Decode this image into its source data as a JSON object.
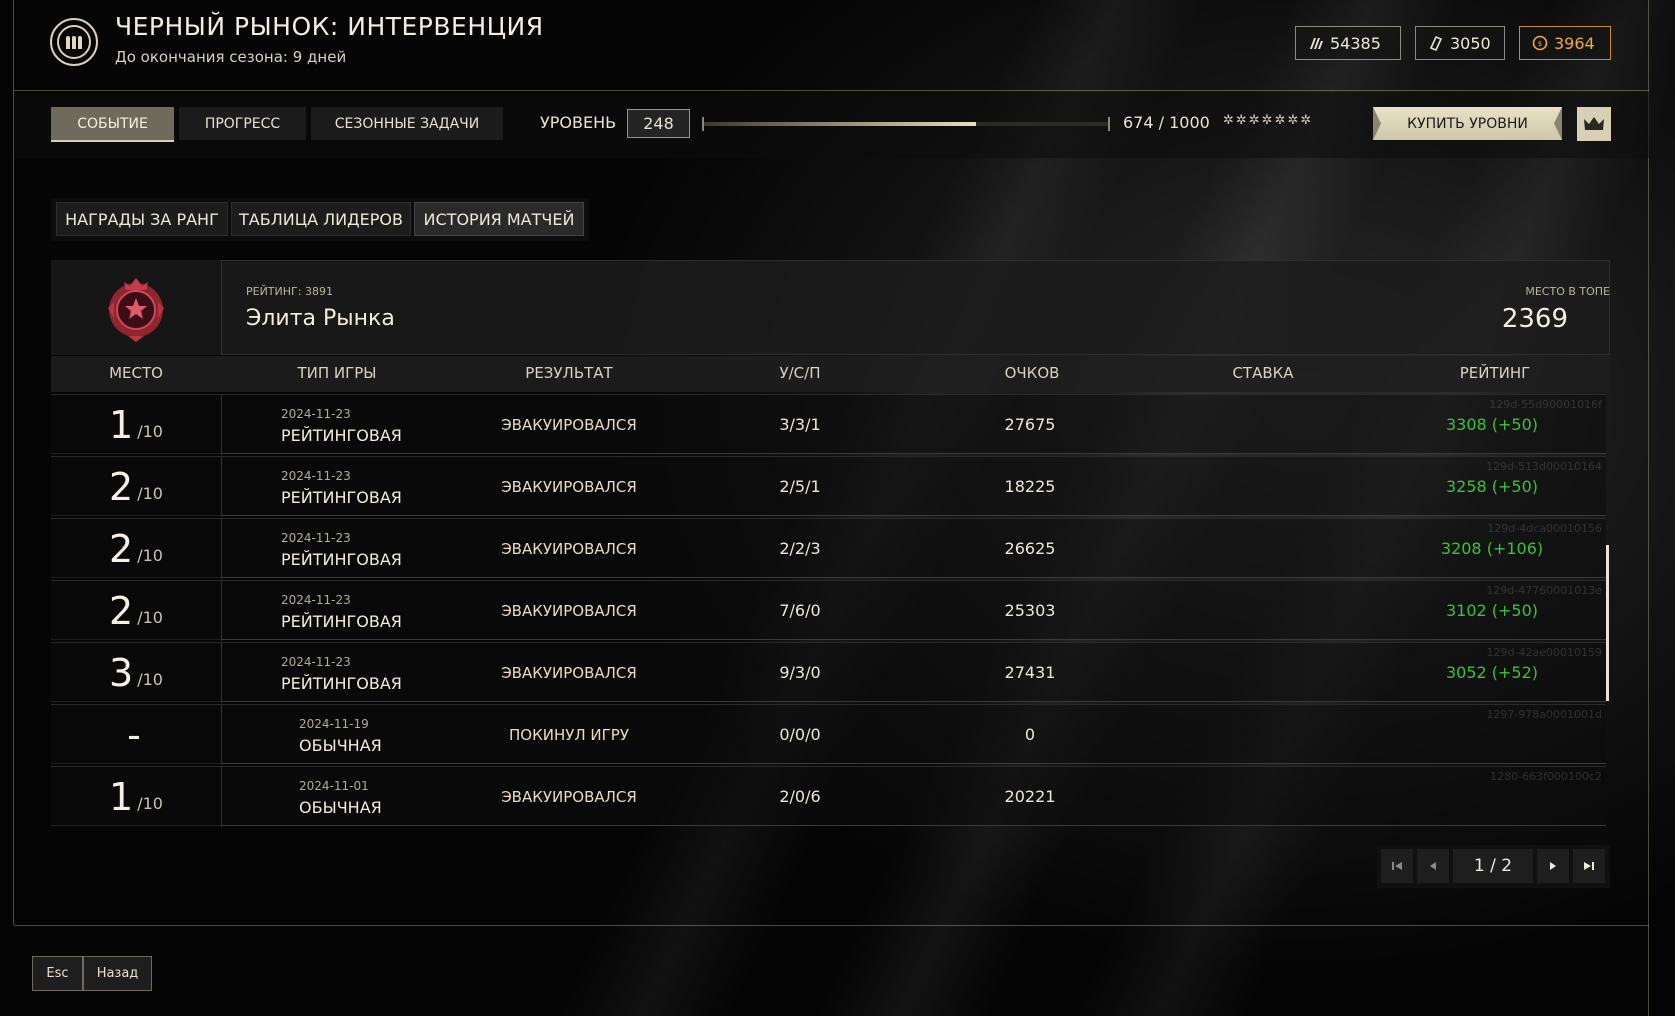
{
  "header": {
    "title": "ЧЕРНЫЙ РЫНОК: ИНТЕРВЕНЦИЯ",
    "subtitle": "До окончания сезона: 9 дней",
    "currencies": [
      {
        "icon": "ammo-currency-icon",
        "value": "54385"
      },
      {
        "icon": "ticket-currency-icon",
        "value": "3050"
      },
      {
        "icon": "coin-currency-icon",
        "value": "3964",
        "color": "#f0a93a"
      }
    ]
  },
  "tabs": [
    "СОБЫТИЕ",
    "ПРОГРЕСС",
    "СЕЗОННЫЕ ЗАДАЧИ"
  ],
  "active_tab": "СОБЫТИЕ",
  "level": {
    "label": "УРОВЕНЬ",
    "value": "248",
    "progress_text": "674 / 1000",
    "progress_fraction": 0.674,
    "stars": "✲✲✲✲✲✲✲"
  },
  "buy_button": "КУПИТЬ УРОВНИ",
  "subtabs": [
    "НАГРАДЫ ЗА РАНГ",
    "ТАБЛИЦА ЛИДЕРОВ",
    "ИСТОРИЯ МАТЧЕЙ"
  ],
  "active_subtab": "ИСТОРИЯ МАТЧЕЙ",
  "rank": {
    "rating_label": "РЕЙТИНГ: 3891",
    "name": "Элита Рынка",
    "top_label": "МЕСТО В ТОПЕ",
    "top_value": "2369"
  },
  "table": {
    "headers": [
      "МЕСТО",
      "ТИП ИГРЫ",
      "РЕЗУЛЬТАТ",
      "У/С/П",
      "ОЧКОВ",
      "СТАВКА",
      "РЕЙТИНГ"
    ],
    "rows": [
      {
        "place": "1",
        "of": "/10",
        "date": "2024-11-23",
        "type": "РЕЙТИНГОВАЯ",
        "result": "ЭВАКУИРОВАЛСЯ",
        "kda": "3/3/1",
        "score": "27675",
        "bet": "",
        "rating": "3308 (+50)",
        "id": "129d-55d90001016f"
      },
      {
        "place": "2",
        "of": "/10",
        "date": "2024-11-23",
        "type": "РЕЙТИНГОВАЯ",
        "result": "ЭВАКУИРОВАЛСЯ",
        "kda": "2/5/1",
        "score": "18225",
        "bet": "",
        "rating": "3258 (+50)",
        "id": "129d-513d00010164"
      },
      {
        "place": "2",
        "of": "/10",
        "date": "2024-11-23",
        "type": "РЕЙТИНГОВАЯ",
        "result": "ЭВАКУИРОВАЛСЯ",
        "kda": "2/2/3",
        "score": "26625",
        "bet": "",
        "rating": "3208 (+106)",
        "id": "129d-4dca00010156"
      },
      {
        "place": "2",
        "of": "/10",
        "date": "2024-11-23",
        "type": "РЕЙТИНГОВАЯ",
        "result": "ЭВАКУИРОВАЛСЯ",
        "kda": "7/6/0",
        "score": "25303",
        "bet": "",
        "rating": "3102 (+50)",
        "id": "129d-47760001013e"
      },
      {
        "place": "3",
        "of": "/10",
        "date": "2024-11-23",
        "type": "РЕЙТИНГОВАЯ",
        "result": "ЭВАКУИРОВАЛСЯ",
        "kda": "9/3/0",
        "score": "27431",
        "bet": "",
        "rating": "3052 (+52)",
        "id": "129d-42ae00010159"
      },
      {
        "place": "-",
        "of": "",
        "date": "2024-11-19",
        "type": "ОБЫЧНАЯ",
        "result": "ПОКИНУЛ ИГРУ",
        "kda": "0/0/0",
        "score": "0",
        "bet": "",
        "rating": "",
        "id": "1297-978a0001001d"
      },
      {
        "place": "1",
        "of": "/10",
        "date": "2024-11-01",
        "type": "ОБЫЧНАЯ",
        "result": "ЭВАКУИРОВАЛСЯ",
        "kda": "2/0/6",
        "score": "20221",
        "bet": "",
        "rating": "",
        "id": "1280-663f000100c2"
      }
    ]
  },
  "pagination": {
    "page": "1 / 2"
  },
  "footer": {
    "esc": "Esc",
    "back": "Назад"
  },
  "colors": {
    "positive_rating": "#39c23a",
    "accent_gold": "#f0a93a",
    "highlight": "#e8dfc0"
  }
}
